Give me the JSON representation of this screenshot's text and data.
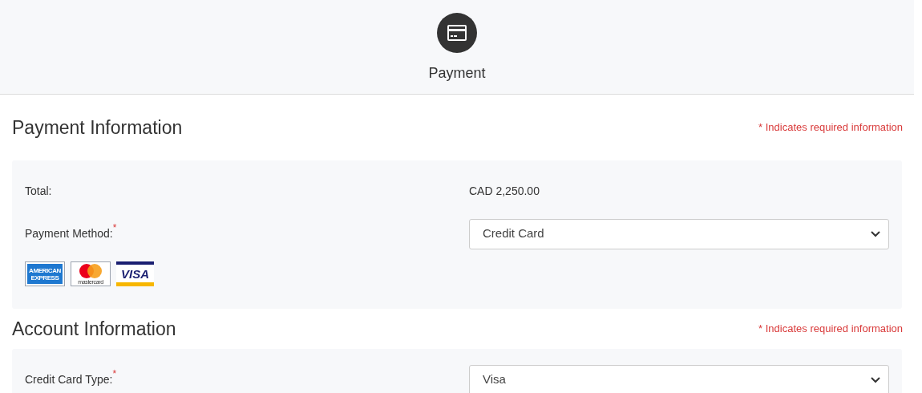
{
  "step": {
    "label": "Payment"
  },
  "sections": [
    {
      "title": "Payment Information",
      "required_note": "* Indicates required information",
      "rows": [
        {
          "kind": "text",
          "label": "Total:",
          "value": "CAD 2,250.00"
        },
        {
          "kind": "select",
          "label": "Payment Method:",
          "required_mark": "*",
          "value": "Credit Card"
        }
      ],
      "card_logos": [
        {
          "kind": "amex",
          "lines": [
            "AMERICAN",
            "EXPRESS"
          ]
        },
        {
          "kind": "mastercard",
          "lines": [
            "mastercard"
          ]
        },
        {
          "kind": "visa",
          "lines": [
            "VISA"
          ]
        }
      ]
    },
    {
      "title": "Account Information",
      "required_note": "* Indicates required information",
      "rows": [
        {
          "kind": "select",
          "label": "Credit Card Type:",
          "required_mark": "*",
          "value": "Visa"
        }
      ]
    }
  ]
}
